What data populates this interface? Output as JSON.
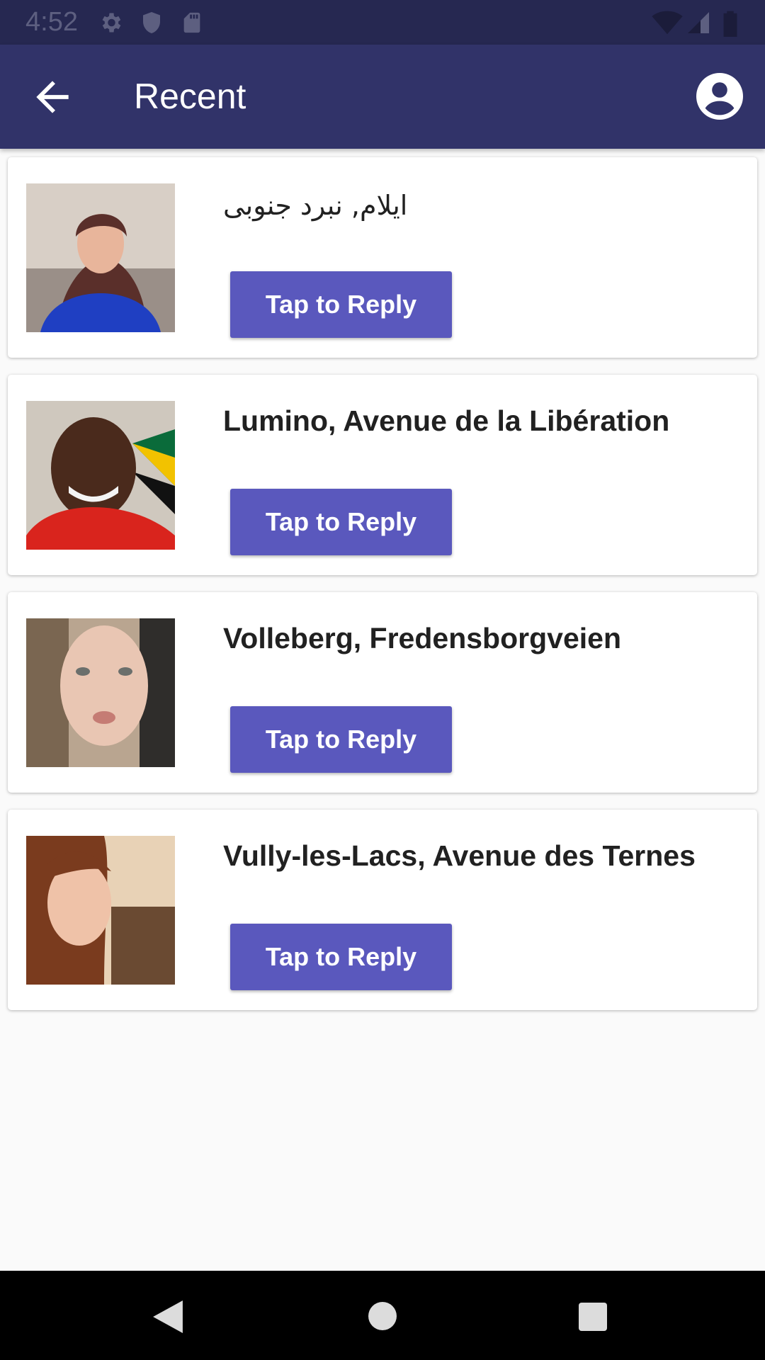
{
  "status_bar": {
    "time": "4:52",
    "icons": [
      "settings-icon",
      "shield-icon",
      "sd-card-icon",
      "wifi-icon",
      "signal-icon",
      "battery-icon"
    ]
  },
  "app_bar": {
    "title": "Recent",
    "back_icon": "arrow-back-icon",
    "account_icon": "account-circle-icon"
  },
  "colors": {
    "status_bar": "#262851",
    "app_bar": "#313369",
    "button": "#5a58bd",
    "background": "#fafafa"
  },
  "items": [
    {
      "title": "ایلام, نبرد جنوبی",
      "button_label": "Tap to Reply"
    },
    {
      "title": "Lumino, Avenue de la Libération",
      "button_label": "Tap to Reply"
    },
    {
      "title": "Volleberg, Fredensborgveien",
      "button_label": "Tap to Reply"
    },
    {
      "title": "Vully-les-Lacs, Avenue des Ternes",
      "button_label": "Tap to Reply"
    }
  ],
  "nav_bar": {
    "icons": [
      "back-triangle-icon",
      "home-circle-icon",
      "recents-square-icon"
    ]
  }
}
